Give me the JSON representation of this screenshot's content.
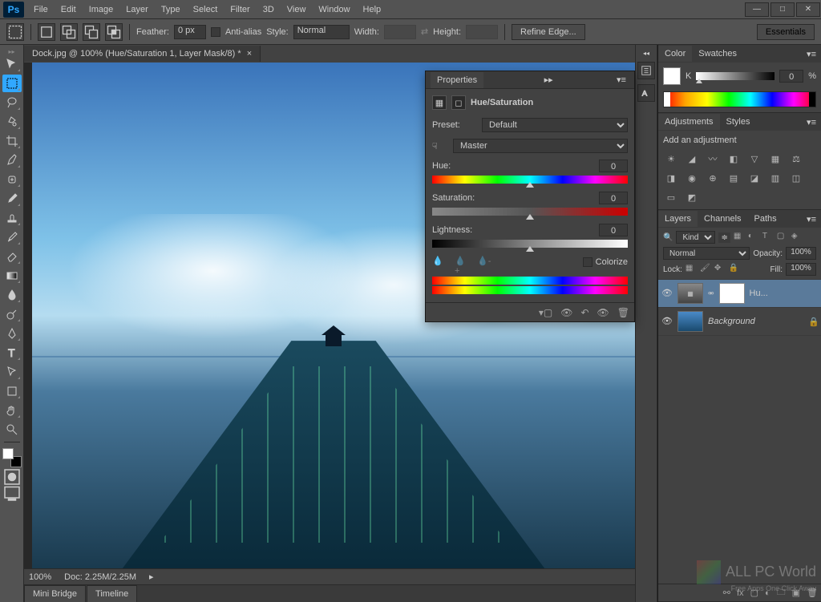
{
  "app": {
    "name": "Ps"
  },
  "menu": [
    "File",
    "Edit",
    "Image",
    "Layer",
    "Type",
    "Select",
    "Filter",
    "3D",
    "View",
    "Window",
    "Help"
  ],
  "options": {
    "feather_label": "Feather:",
    "feather_val": "0 px",
    "anti_alias": "Anti-alias",
    "style_label": "Style:",
    "style_val": "Normal",
    "width_label": "Width:",
    "height_label": "Height:",
    "refine": "Refine Edge...",
    "essentials": "Essentials"
  },
  "doc": {
    "tab": "Dock.jpg @ 100% (Hue/Saturation 1, Layer Mask/8) *",
    "zoom": "100%",
    "doc_info": "Doc: 2.25M/2.25M"
  },
  "bottom_tabs": [
    "Mini Bridge",
    "Timeline"
  ],
  "properties": {
    "title": "Properties",
    "adj_title": "Hue/Saturation",
    "preset_label": "Preset:",
    "preset_val": "Default",
    "range_val": "Master",
    "hue_label": "Hue:",
    "hue_val": "0",
    "sat_label": "Saturation:",
    "sat_val": "0",
    "light_label": "Lightness:",
    "light_val": "0",
    "colorize": "Colorize"
  },
  "color_panel": {
    "tab1": "Color",
    "tab2": "Swatches",
    "k_label": "K",
    "k_val": "0",
    "pct": "%"
  },
  "adjustments_panel": {
    "tab1": "Adjustments",
    "tab2": "Styles",
    "heading": "Add an adjustment"
  },
  "layers_panel": {
    "tab1": "Layers",
    "tab2": "Channels",
    "tab3": "Paths",
    "kind_label": "Kind",
    "blend": "Normal",
    "opacity_label": "Opacity:",
    "opacity_val": "100%",
    "lock_label": "Lock:",
    "fill_label": "Fill:",
    "fill_val": "100%",
    "layers": [
      {
        "name": "Hu...",
        "selected": true,
        "has_mask": true
      },
      {
        "name": "Background",
        "selected": false,
        "locked": true
      }
    ]
  },
  "watermark": {
    "main": "ALL PC World",
    "sub": "Free Apps One Click Away"
  }
}
